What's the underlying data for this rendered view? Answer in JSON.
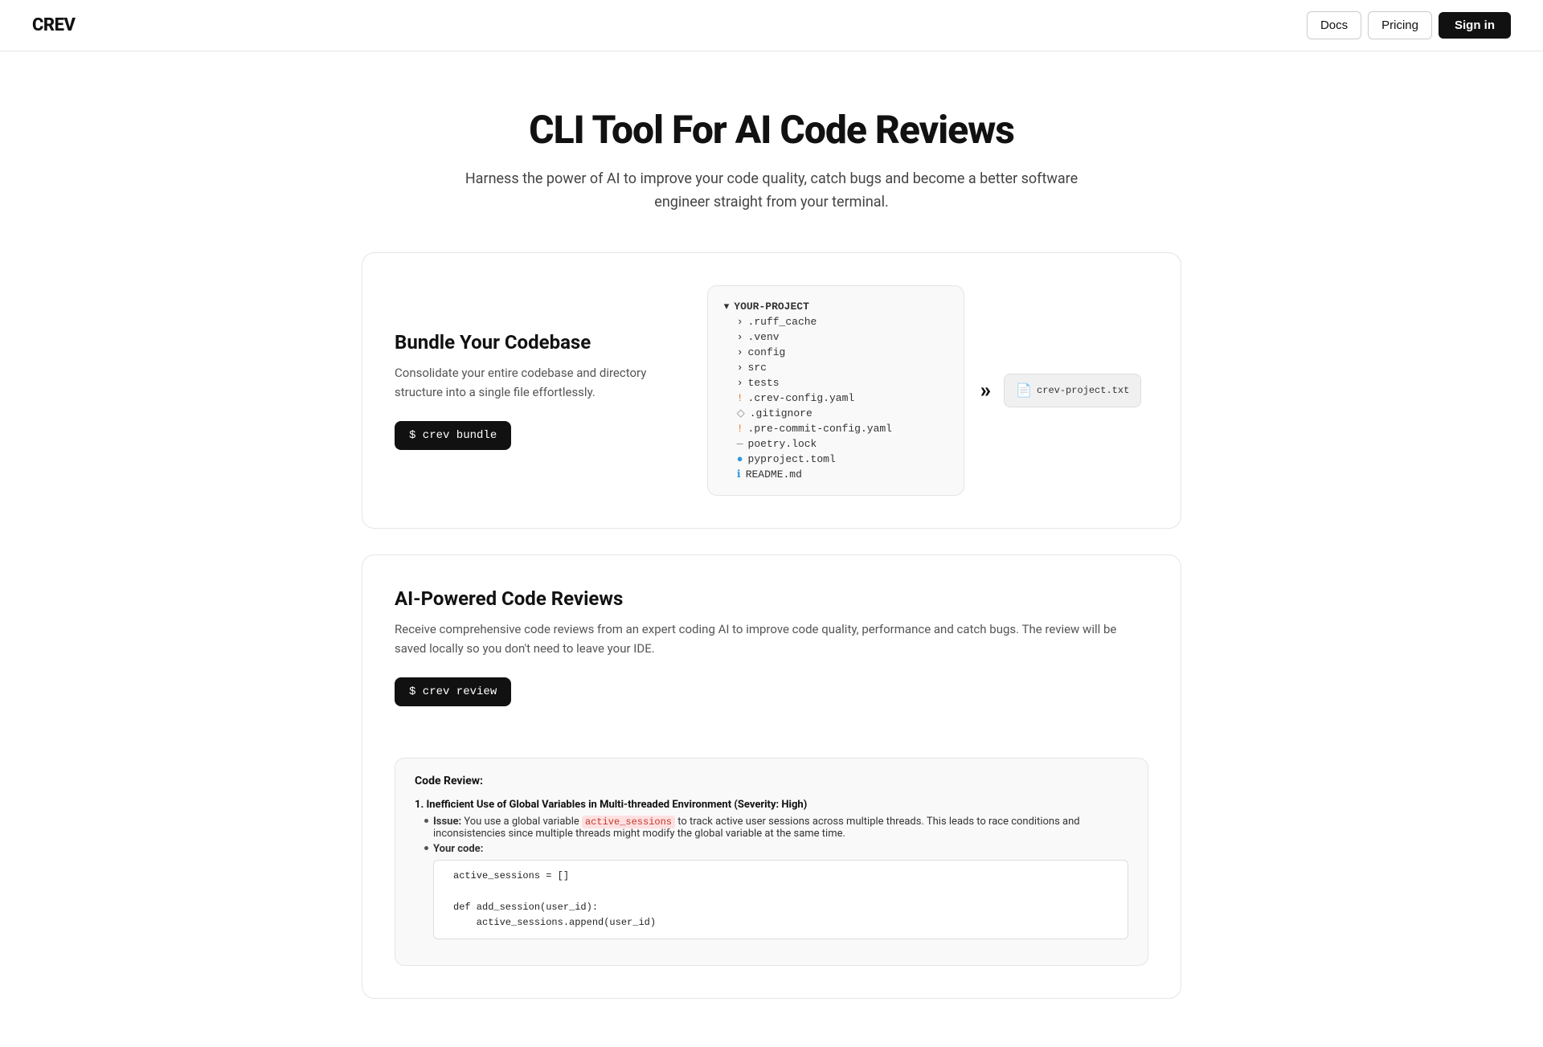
{
  "navbar": {
    "logo": "CREV",
    "docs_label": "Docs",
    "pricing_label": "Pricing",
    "signin_label": "Sign in"
  },
  "hero": {
    "title": "CLI Tool For AI Code Reviews",
    "subtitle": "Harness the power of AI to improve your code quality, catch bugs and become a better software engineer straight from your terminal."
  },
  "section_bundle": {
    "title": "Bundle Your Codebase",
    "description": "Consolidate your entire codebase and directory structure into a single file effortlessly.",
    "command": "$ crev bundle",
    "file_tree": {
      "root": "YOUR-PROJECT",
      "items": [
        {
          "indent": 1,
          "type": "folder",
          "name": ".ruff_cache"
        },
        {
          "indent": 1,
          "type": "folder",
          "name": ".venv"
        },
        {
          "indent": 1,
          "type": "folder",
          "name": "config"
        },
        {
          "indent": 1,
          "type": "folder",
          "name": "src"
        },
        {
          "indent": 1,
          "type": "folder",
          "name": "tests"
        },
        {
          "indent": 1,
          "type": "file",
          "name": ".crev-config.yaml",
          "icon": "!"
        },
        {
          "indent": 1,
          "type": "file",
          "name": ".gitignore",
          "icon": "◇"
        },
        {
          "indent": 1,
          "type": "file",
          "name": ".pre-commit-config.yaml",
          "icon": "!"
        },
        {
          "indent": 1,
          "type": "file",
          "name": "poetry.lock",
          "icon": "—"
        },
        {
          "indent": 1,
          "type": "file",
          "name": "pyproject.toml",
          "icon": "●"
        },
        {
          "indent": 1,
          "type": "file",
          "name": "README.md",
          "icon": "ℹ"
        }
      ]
    },
    "output_file": "crev-project.txt"
  },
  "section_review": {
    "title": "AI-Powered Code Reviews",
    "description": "Receive comprehensive code reviews from an expert coding AI to improve code quality, performance and catch bugs. The review will be saved locally so you don't need to leave your IDE.",
    "command": "$ crev review",
    "review_demo": {
      "title": "Code Review:",
      "item_number": "1.",
      "item_title": "Inefficient Use of Global Variables in Multi-threaded Environment (Severity: High)",
      "issue_label": "Issue:",
      "issue_text": "You use a global variable",
      "issue_var": "active_sessions",
      "issue_text2": "to track active user sessions across multiple threads. This leads to race conditions and inconsistencies since multiple threads might modify the global variable at the same time.",
      "code_label": "Your code:",
      "code_lines": [
        "active_sessions = []",
        "",
        "def add_session(user_id):",
        "    active_sessions.append(user_id)"
      ]
    }
  }
}
